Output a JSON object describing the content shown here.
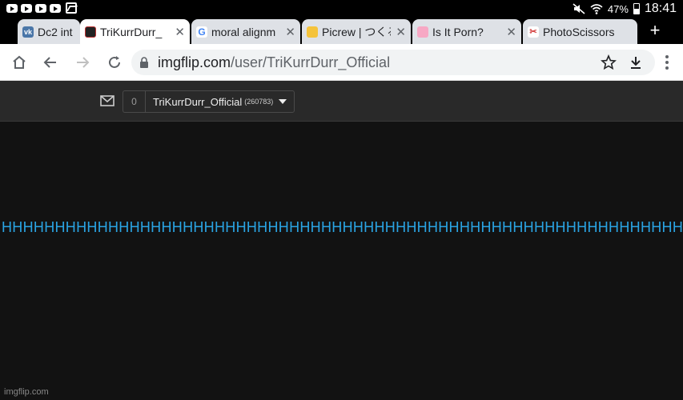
{
  "status_bar": {
    "battery": "47%",
    "time": "18:41",
    "left_icons": [
      "youtube-icon",
      "youtube-icon",
      "youtube-icon",
      "youtube-icon",
      "gallery-icon"
    ],
    "right_icons": [
      "mute-icon",
      "wifi-icon",
      "battery-icon"
    ]
  },
  "tabs": [
    {
      "title": "Dc2 int",
      "favicon": "vk-icon",
      "fav_color": "#4a76a8",
      "active": false
    },
    {
      "title": "TriKurrDurr_",
      "favicon": "imgflip-icon",
      "fav_color": "#222222",
      "active": true
    },
    {
      "title": "moral alignm",
      "favicon": "google-icon",
      "fav_color": "#ffffff",
      "active": false
    },
    {
      "title": "Picrew | つくる",
      "favicon": "picrew-icon",
      "fav_color": "#f5c33b",
      "active": false
    },
    {
      "title": "Is It Porn?",
      "favicon": "isitporn-icon",
      "fav_color": "#f7a8c4",
      "active": false
    },
    {
      "title": "PhotoScissors",
      "favicon": "photoscissors-icon",
      "fav_color": "#d33b3b",
      "active": false
    }
  ],
  "toolbar": {
    "url_host": "imgflip.com",
    "url_path": "/user/TriKurrDurr_Official"
  },
  "site_header": {
    "notification_count": "0",
    "username": "TriKurrDurr_Official",
    "points": "(260783)"
  },
  "content": {
    "text": "HHHHHHHHHHHHHHHHHHHHHHHHHHHHHHHHHHHHHHHHHHHHHHHHHHHHHHHHHHHHHHHHHHHHHHHH",
    "text_color": "#2aa4e3"
  },
  "watermark": "imgflip.com"
}
